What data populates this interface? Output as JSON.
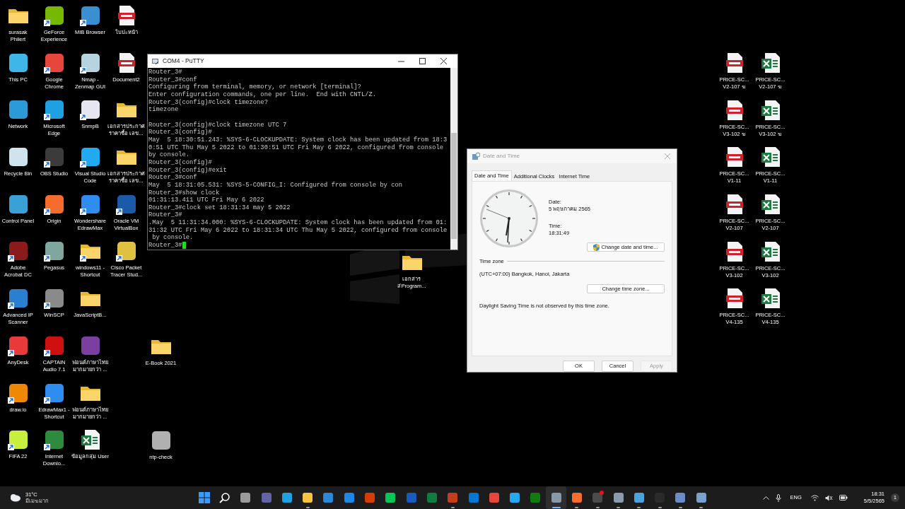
{
  "desktop_columns": [
    {
      "icons": [
        {
          "kind": "folder",
          "label": "surasak\nPhilert",
          "shortcut": false
        },
        {
          "kind": "app",
          "color": "#3fb6e8",
          "label": "This PC",
          "shortcut": false
        },
        {
          "kind": "app",
          "color": "#2d9ad8",
          "label": "Network",
          "shortcut": false
        },
        {
          "kind": "app",
          "color": "#cfe3ef",
          "label": "Recycle Bin",
          "shortcut": false
        },
        {
          "kind": "app",
          "color": "#3aa0d8",
          "label": "Control Panel",
          "shortcut": false
        },
        {
          "kind": "app",
          "color": "#8b1a1a",
          "label": "Adobe\nAcrobat DC",
          "shortcut": true
        },
        {
          "kind": "app",
          "color": "#2b7fd0",
          "label": "Advanced IP\nScanner",
          "shortcut": true
        },
        {
          "kind": "app",
          "color": "#e8393b",
          "label": "AnyDesk",
          "shortcut": true
        },
        {
          "kind": "app",
          "color": "#f08705",
          "label": "draw.io",
          "shortcut": true
        },
        {
          "kind": "app",
          "color": "#c7f03c",
          "label": "FIFA 22",
          "shortcut": true
        }
      ]
    },
    {
      "icons": [
        {
          "kind": "app",
          "color": "#76b900",
          "label": "GeForce\nExperience",
          "shortcut": true
        },
        {
          "kind": "app",
          "color": "#e8453c",
          "label": "Google\nChrome",
          "shortcut": true
        },
        {
          "kind": "app",
          "color": "#1fa0e0",
          "label": "Microsoft\nEdge",
          "shortcut": true
        },
        {
          "kind": "app",
          "color": "#3b3b3b",
          "label": "OBS Studio",
          "shortcut": true
        },
        {
          "kind": "app",
          "color": "#f56c2d",
          "label": "Origin",
          "shortcut": true
        },
        {
          "kind": "app",
          "color": "#7fa7a0",
          "label": "Pegasus",
          "shortcut": true
        },
        {
          "kind": "app",
          "color": "#8a8a8a",
          "label": "WinSCP",
          "shortcut": true
        },
        {
          "kind": "app",
          "color": "#d01010",
          "label": "CAPTAIN\nAudio 7.1",
          "shortcut": true
        },
        {
          "kind": "app",
          "color": "#2f8cf0",
          "label": "EdrawMax1 -\nShortcut",
          "shortcut": true
        },
        {
          "kind": "app",
          "color": "#2e8b3e",
          "label": "Internet\nDownlo...",
          "shortcut": true
        }
      ]
    },
    {
      "icons": [
        {
          "kind": "app",
          "color": "#3a8fd0",
          "label": "MIB Browser",
          "shortcut": true
        },
        {
          "kind": "app",
          "color": "#b7d3e0",
          "label": "Nmap -\nZenmap GUI",
          "shortcut": true
        },
        {
          "kind": "app",
          "color": "#e6e6f0",
          "label": "SnmpB",
          "shortcut": true
        },
        {
          "kind": "app",
          "color": "#23a9f2",
          "label": "Visual Studio\nCode",
          "shortcut": true
        },
        {
          "kind": "app",
          "color": "#2f8cf0",
          "label": "Wondershare\nEdrawMax",
          "shortcut": true
        },
        {
          "kind": "folder",
          "label": "windows11 -\nShortcut",
          "shortcut": true
        },
        {
          "kind": "folder",
          "label": "JavaScriptB...",
          "shortcut": false
        },
        {
          "kind": "app",
          "color": "#7a3fa0",
          "label": "ฟอนต์ภาษาไทย\nมากมายกว่า ...",
          "shortcut": false
        },
        {
          "kind": "folder",
          "label": "ฟอนต์ภาษาไทย\nมากมายกว่า ...",
          "shortcut": false
        },
        {
          "kind": "excel",
          "label": "ข้อมูลกลุ่ม User",
          "shortcut": false
        }
      ]
    },
    {
      "icons": [
        {
          "kind": "pdf",
          "label": "ใบปะหน้า",
          "shortcut": false
        },
        {
          "kind": "pdf",
          "label": "Document2",
          "shortcut": false
        },
        {
          "kind": "folder",
          "label": "เอกสารประกาศ\nราคาซื้อ เลข...",
          "shortcut": false
        },
        {
          "kind": "folder",
          "label": "เอกสารประกาศ\nราคาซื้อ เลข...",
          "shortcut": false
        },
        {
          "kind": "app",
          "color": "#1b5aa8",
          "label": "Oracle VM\nVirtualBox",
          "shortcut": true
        },
        {
          "kind": "app",
          "color": "#e0c040",
          "label": "Cisco Packet\nTracer Stud...",
          "shortcut": true
        }
      ]
    }
  ],
  "loose_icons": [
    {
      "kind": "folder",
      "label": "E-Book 2021",
      "shortcut": false
    },
    {
      "kind": "app",
      "color": "#b0b0b0",
      "label": "ntp-check",
      "shortcut": false
    },
    {
      "kind": "folder",
      "label": "เอกสาร\nส่Program...",
      "shortcut": false
    }
  ],
  "right_columns": [
    {
      "icons": [
        {
          "kind": "pdf",
          "label": "PRICE-SC...\nV2-107 ฆ",
          "shortcut": false
        },
        {
          "kind": "pdf",
          "label": "PRICE-SC...\nV3-102 ฆ",
          "shortcut": false
        },
        {
          "kind": "pdf",
          "label": "PRICE-SC...\nV1-11",
          "shortcut": false
        },
        {
          "kind": "pdf",
          "label": "PRICE-SC...\nV2-107",
          "shortcut": false
        },
        {
          "kind": "pdf",
          "label": "PRICE-SC...\nV3-102",
          "shortcut": false
        },
        {
          "kind": "pdf",
          "label": "PRICE-SC...\nV4-135",
          "shortcut": false
        }
      ]
    },
    {
      "icons": [
        {
          "kind": "excel",
          "label": "PRICE-SC...\nV2-107 ฆ",
          "shortcut": false
        },
        {
          "kind": "excel",
          "label": "PRICE-SC...\nV3-102 ฆ",
          "shortcut": false
        },
        {
          "kind": "excel",
          "label": "PRICE-SC...\nV1-11",
          "shortcut": false
        },
        {
          "kind": "excel",
          "label": "PRICE-SC...\nV2-107",
          "shortcut": false
        },
        {
          "kind": "excel",
          "label": "PRICE-SC...\nV3-102",
          "shortcut": false
        },
        {
          "kind": "excel",
          "label": "PRICE-SC...\nV4-135",
          "shortcut": false
        }
      ]
    }
  ],
  "putty": {
    "title": "COM4 - PuTTY",
    "output": "Router_3#\nRouter_3#conf\nConfiguring from terminal, memory, or network [terminal]?\nEnter configuration commands, one per line.  End with CNTL/Z.\nRouter_3(config)#clock timezone?\ntimezone\n\nRouter_3(config)#clock timezone UTC 7\nRouter_3(config)#\nMay  5 18:30:51.243: %SYS-6-CLOCKUPDATE: System clock has been updated from 18:3\n0:51 UTC Thu May 5 2022 to 01:30:51 UTC Fri May 6 2022, configured from console\nby console.\nRouter_3(config)#\nRouter_3(config)#exit\nRouter_3#conf\nMay  5 18:31:05.531: %SYS-5-CONFIG_I: Configured from console by con\nRouter_3#show clock\n01:31:13.411 UTC Fri May 6 2022\nRouter_3#clock set 18:31:34 may 5 2022\nRouter_3#\n.May  5 11:31:34.000: %SYS-6-CLOCKUPDATE: System clock has been updated from 01:\n31:32 UTC Fri May 6 2022 to 18:31:34 UTC Thu May 5 2022, configured from console\n by console.",
    "prompt": "Router_3#"
  },
  "date_time_dialog": {
    "title": "Date and Time",
    "tabs": [
      {
        "label": "Date and Time",
        "selected": true
      },
      {
        "label": "Additional Clocks",
        "selected": false
      },
      {
        "label": "Internet Time",
        "selected": false
      }
    ],
    "date_label": "Date:",
    "date_value": "5 พฤษภาคม 2565",
    "time_label": "Time:",
    "time_value": "18:31:49",
    "change_date_button": "Change date and time...",
    "time_zone_heading": "Time zone",
    "time_zone": "(UTC+07:00) Bangkok, Hanoi, Jakarta",
    "change_zone_button": "Change time zone...",
    "dst_note": "Daylight Saving Time is not observed by this time zone.",
    "buttons": [
      {
        "label": "OK",
        "disabled": false
      },
      {
        "label": "Cancel",
        "disabled": false
      },
      {
        "label": "Apply",
        "disabled": true
      }
    ]
  },
  "taskbar": {
    "weather": {
      "temperature": "31°C",
      "condition": "มีเมฆมาก"
    },
    "apps": [
      {
        "kind": "start",
        "color": "#3b9cff",
        "running": false,
        "active": false,
        "alert": false
      },
      {
        "kind": "search",
        "color": "#ffffff",
        "running": false,
        "active": false,
        "alert": false
      },
      {
        "kind": "app",
        "color": "#9a9a9a",
        "running": false,
        "active": false,
        "alert": false
      },
      {
        "kind": "app",
        "color": "#6264a7",
        "running": false,
        "active": false,
        "alert": false
      },
      {
        "kind": "app",
        "color": "#1fa0e0",
        "running": false,
        "active": false,
        "alert": false
      },
      {
        "kind": "app",
        "color": "#f5c542",
        "running": true,
        "active": false,
        "alert": false
      },
      {
        "kind": "app",
        "color": "#2b88d8",
        "running": false,
        "active": false,
        "alert": false
      },
      {
        "kind": "app",
        "color": "#1e88e5",
        "running": false,
        "active": false,
        "alert": false
      },
      {
        "kind": "app",
        "color": "#d83b01",
        "running": false,
        "active": false,
        "alert": false
      },
      {
        "kind": "app",
        "color": "#06c755",
        "running": false,
        "active": false,
        "alert": false
      },
      {
        "kind": "app",
        "color": "#185abd",
        "running": false,
        "active": false,
        "alert": false
      },
      {
        "kind": "app",
        "color": "#107c41",
        "running": false,
        "active": false,
        "alert": false
      },
      {
        "kind": "app",
        "color": "#c43e1c",
        "running": true,
        "active": false,
        "alert": false
      },
      {
        "kind": "app",
        "color": "#0078d4",
        "running": false,
        "active": false,
        "alert": false
      },
      {
        "kind": "app",
        "color": "#e8453c",
        "running": false,
        "active": false,
        "alert": false
      },
      {
        "kind": "app",
        "color": "#23a9f2",
        "running": false,
        "active": false,
        "alert": false
      },
      {
        "kind": "app",
        "color": "#107c10",
        "running": false,
        "active": false,
        "alert": false
      },
      {
        "kind": "app",
        "color": "#8899aa",
        "running": true,
        "active": true,
        "alert": false
      },
      {
        "kind": "app",
        "color": "#f56c2d",
        "running": true,
        "active": false,
        "alert": false
      },
      {
        "kind": "app",
        "color": "#4a4a4a",
        "running": true,
        "active": false,
        "alert": true
      },
      {
        "kind": "app",
        "color": "#8a9bb0",
        "running": true,
        "active": false,
        "alert": false
      },
      {
        "kind": "app",
        "color": "#4aa3df",
        "running": true,
        "active": false,
        "alert": false
      },
      {
        "kind": "app",
        "color": "#2a2a2a",
        "running": true,
        "active": false,
        "alert": false
      },
      {
        "kind": "app",
        "color": "#6a8cc8",
        "running": true,
        "active": false,
        "alert": false
      },
      {
        "kind": "app",
        "color": "#7aa0d0",
        "running": true,
        "active": false,
        "alert": false
      }
    ],
    "language": "ENG",
    "time": "18:31",
    "date": "5/5/2565",
    "notifications": "1"
  }
}
